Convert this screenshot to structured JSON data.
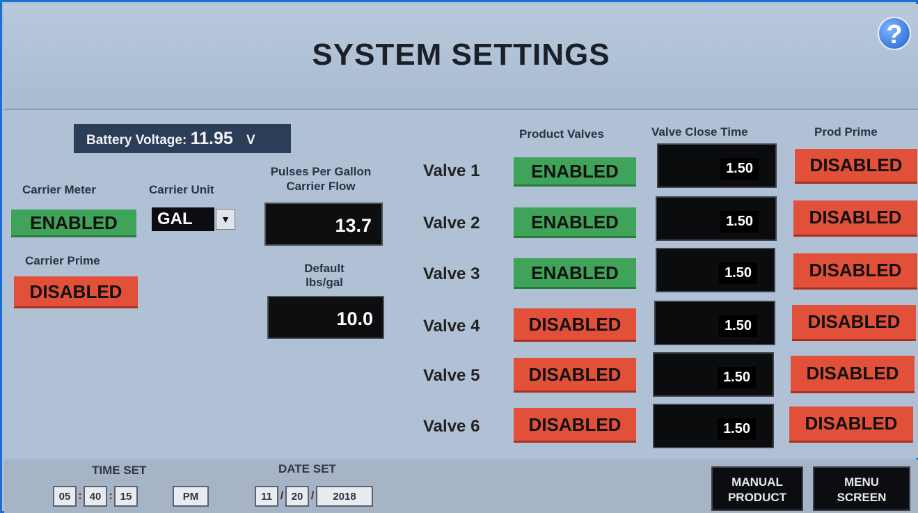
{
  "header": {
    "title": "SYSTEM SETTINGS",
    "help": "?"
  },
  "battery": {
    "label": "Battery Voltage:",
    "value": "11.95",
    "unit": "V"
  },
  "carrier_meter": {
    "label": "Carrier Meter",
    "status": "ENABLED"
  },
  "carrier_unit": {
    "label": "Carrier Unit",
    "value": "GAL",
    "arrow": "▼"
  },
  "carrier_prime": {
    "label": "Carrier Prime",
    "status": "DISABLED"
  },
  "pulses": {
    "label_line1": "Pulses Per Gallon",
    "label_line2": "Carrier Flow",
    "value": "13.7"
  },
  "default_lbs": {
    "label_line1": "Default",
    "label_line2": "lbs/gal",
    "value": "10.0"
  },
  "columns": {
    "product_valves": "Product Valves",
    "valve_close_time": "Valve Close Time",
    "prod_prime": "Prod Prime"
  },
  "valves": [
    {
      "name": "Valve 1",
      "product": "ENABLED",
      "close_time": "1.50",
      "prime": "DISABLED"
    },
    {
      "name": "Valve 2",
      "product": "ENABLED",
      "close_time": "1.50",
      "prime": "DISABLED"
    },
    {
      "name": "Valve 3",
      "product": "ENABLED",
      "close_time": "1.50",
      "prime": "DISABLED"
    },
    {
      "name": "Valve 4",
      "product": "DISABLED",
      "close_time": "1.50",
      "prime": "DISABLED"
    },
    {
      "name": "Valve 5",
      "product": "DISABLED",
      "close_time": "1.50",
      "prime": "DISABLED"
    },
    {
      "name": "Valve 6",
      "product": "DISABLED",
      "close_time": "1.50",
      "prime": "DISABLED"
    }
  ],
  "time_set": {
    "label": "TIME SET",
    "hour": "05",
    "minute": "40",
    "second": "15",
    "ampm": "PM",
    "sep": ":"
  },
  "date_set": {
    "label": "DATE SET",
    "month": "11",
    "day": "20",
    "year": "2018",
    "sep": "/"
  },
  "nav": {
    "manual_line1": "MANUAL",
    "manual_line2": "PRODUCT",
    "menu_line1": "MENU",
    "menu_line2": "SCREEN"
  },
  "colors": {
    "enabled": "#3fa35a",
    "disabled": "#e2503a",
    "panel": "#b0c1d6",
    "frame": "#1a6fd6"
  }
}
